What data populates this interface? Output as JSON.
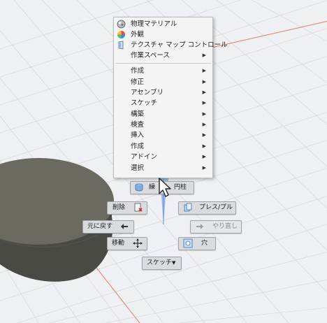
{
  "context_menu": {
    "top_items": [
      {
        "label": "物理マテリアル",
        "icon": "physical-material-icon",
        "submenu": false
      },
      {
        "label": "外観",
        "icon": "appearance-icon",
        "submenu": false
      },
      {
        "label": "テクスチャ マップ コントロール",
        "icon": "texture-map-icon",
        "submenu": false
      },
      {
        "label": "作業スペース",
        "icon": "",
        "submenu": true
      }
    ],
    "items": [
      {
        "label": "作成",
        "submenu": true
      },
      {
        "label": "修正",
        "submenu": true
      },
      {
        "label": "アセンブリ",
        "submenu": true
      },
      {
        "label": "スケッチ",
        "submenu": true
      },
      {
        "label": "構築",
        "submenu": true
      },
      {
        "label": "検査",
        "submenu": true
      },
      {
        "label": "挿入",
        "submenu": true
      },
      {
        "label": "作成",
        "submenu": true
      },
      {
        "label": "アドイン",
        "submenu": true
      },
      {
        "label": "選択",
        "submenu": true
      }
    ],
    "submenu_arrow": "▶"
  },
  "marking_menu": {
    "repeat_label": "繰",
    "repeat_extra": "円柱",
    "delete_label": "削除",
    "presspull_label": "プレス/プル",
    "undo_label": "元に戻す",
    "redo_label": "やり直し",
    "move_label": "移動",
    "hole_label": "穴",
    "sketch_label": "スケッチ",
    "dropdown_arrow": "▼"
  },
  "colors": {
    "canvas_bg": "#eef0f3",
    "grid": "#d3d6da",
    "body_dark": "#4a4a44",
    "body_top": "#6b6a60",
    "axis_blue": "#6a8fd6",
    "axis_red": "#e07a6a",
    "menu_bg": "#f4f4f4",
    "button_bg": "#d9dbde"
  }
}
